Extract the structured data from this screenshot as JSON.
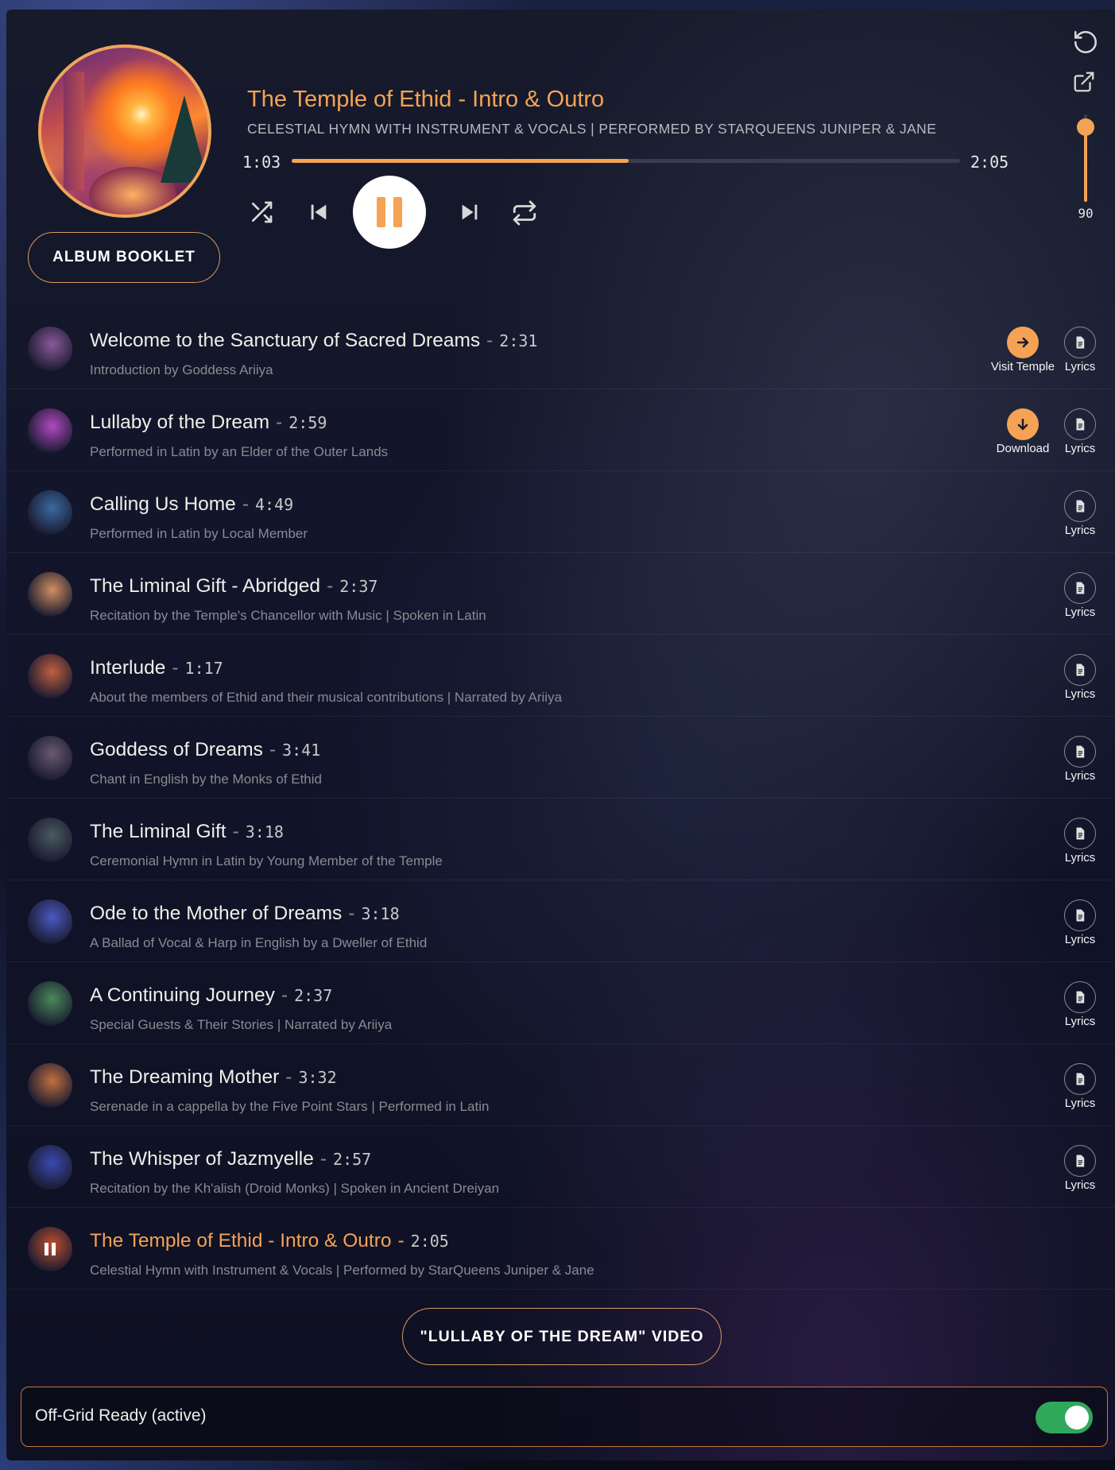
{
  "now_playing": {
    "title": "The Temple of Ethid - Intro & Outro",
    "subtitle": "CELESTIAL HYMN WITH INSTRUMENT & VOCALS | PERFORMED BY STARQUEENS JUNIPER & JANE",
    "current_time": "1:03",
    "total_time": "2:05",
    "progress_fraction": 0.504
  },
  "volume": {
    "value": "90",
    "level_fraction": 0.9
  },
  "buttons": {
    "album_booklet": "ALBUM BOOKLET",
    "video": "\"LULLABY OF THE DREAM\" VIDEO"
  },
  "icons": {
    "reset": "reset-icon",
    "popout": "external-link-icon",
    "shuffle": "shuffle-icon",
    "previous": "skip-previous-icon",
    "pause": "pause-icon",
    "next": "skip-next-icon",
    "repeat": "repeat-icon"
  },
  "colors": {
    "accent": "#f5a255",
    "toggle_on": "#2fa85a"
  },
  "tracks": [
    {
      "name": "Welcome to the Sanctuary of Sacred Dreams",
      "duration": "2:31",
      "desc": "Introduction by Goddess Ariiya",
      "extra": "Visit Temple",
      "lyrics": "Lyrics",
      "thumb": "#8a5a9a"
    },
    {
      "name": "Lullaby of the Dream",
      "duration": "2:59",
      "desc": "Performed in Latin by an Elder of the Outer Lands",
      "extra": "Download",
      "lyrics": "Lyrics",
      "thumb": "#b04ac0"
    },
    {
      "name": "Calling Us Home",
      "duration": "4:49",
      "desc": "Performed in Latin by Local Member",
      "extra": "",
      "lyrics": "Lyrics",
      "thumb": "#3a6aa0"
    },
    {
      "name": "The Liminal Gift - Abridged",
      "duration": "2:37",
      "desc": "Recitation by the Temple's Chancellor with Music | Spoken in Latin",
      "extra": "",
      "lyrics": "Lyrics",
      "thumb": "#d09060"
    },
    {
      "name": "Interlude",
      "duration": "1:17",
      "desc": "About the members of Ethid and their musical contributions | Narrated by Ariiya",
      "extra": "",
      "lyrics": "Lyrics",
      "thumb": "#c06040"
    },
    {
      "name": "Goddess of Dreams",
      "duration": "3:41",
      "desc": "Chant in English by the Monks of Ethid",
      "extra": "",
      "lyrics": "Lyrics",
      "thumb": "#6a5a70"
    },
    {
      "name": "The Liminal Gift",
      "duration": "3:18",
      "desc": "Ceremonial Hymn in Latin by Young Member of the Temple",
      "extra": "",
      "lyrics": "Lyrics",
      "thumb": "#4a5a60"
    },
    {
      "name": "Ode to the Mother of Dreams",
      "duration": "3:18",
      "desc": "A Ballad of Vocal & Harp in English by a Dweller of Ethid",
      "extra": "",
      "lyrics": "Lyrics",
      "thumb": "#4a5ac0"
    },
    {
      "name": "A Continuing Journey",
      "duration": "2:37",
      "desc": "Special Guests & Their Stories | Narrated by Ariiya",
      "extra": "",
      "lyrics": "Lyrics",
      "thumb": "#4a8a5a"
    },
    {
      "name": "The Dreaming Mother",
      "duration": "3:32",
      "desc": "Serenade in a cappella by the Five Point Stars | Performed in Latin",
      "extra": "",
      "lyrics": "Lyrics",
      "thumb": "#c07040"
    },
    {
      "name": "The Whisper of Jazmyelle",
      "duration": "2:57",
      "desc": "Recitation by the Kh'alish (Droid Monks) | Spoken in Ancient Dreiyan",
      "extra": "",
      "lyrics": "Lyrics",
      "thumb": "#3a4ab0"
    },
    {
      "name": "The Temple of Ethid - Intro & Outro",
      "duration": "2:05",
      "desc": "Celestial Hymn with Instrument & Vocals | Performed by StarQueens Juniper & Jane",
      "extra": "",
      "lyrics": "",
      "thumb": "#c05030",
      "active": true
    }
  ],
  "offgrid": {
    "label": "Off-Grid Ready (active)",
    "enabled": true
  }
}
